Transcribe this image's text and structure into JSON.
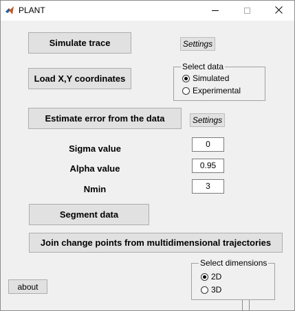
{
  "window": {
    "title": "PLANT",
    "controls": {
      "minimize": "—",
      "maximize": "☐",
      "close": "✕"
    }
  },
  "buttons": {
    "simulate_trace": "Simulate trace",
    "settings_1": "Settings",
    "load_xy": "Load X,Y coordinates",
    "estimate_error": "Estimate error from the data",
    "settings_2": "Settings",
    "segment_data": "Segment data",
    "join_change_points": "Join change points from multidimensional trajectories",
    "about": "about"
  },
  "select_data": {
    "title": "Select data",
    "options": [
      {
        "label": "Simulated",
        "checked": true
      },
      {
        "label": "Experimental",
        "checked": false
      }
    ]
  },
  "params": {
    "sigma_label": "Sigma value",
    "sigma_value": "0",
    "alpha_label": "Alpha value",
    "alpha_value": "0.95",
    "nmin_label": "Nmin",
    "nmin_value": "3"
  },
  "select_dimensions": {
    "title": "Select dimensions",
    "options": [
      {
        "label": "2D",
        "checked": true
      },
      {
        "label": "3D",
        "checked": false
      }
    ]
  },
  "colors": {
    "window_bg": "#f0f0f0",
    "button_bg": "#e1e1e1",
    "titlebar_bg": "#ffffff"
  }
}
